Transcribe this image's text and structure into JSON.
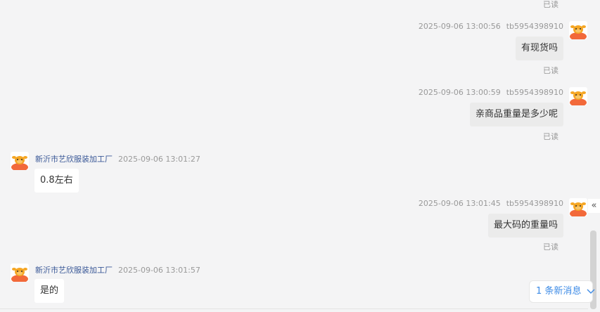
{
  "top_read": "已读",
  "messages": [
    {
      "time": "2025-09-06 13:00:56",
      "sender": "tb5954398910",
      "text": "有现货吗",
      "read": "已读"
    },
    {
      "time": "2025-09-06 13:00:59",
      "sender": "tb5954398910",
      "text": "亲商品重量是多少呢",
      "read": "已读"
    },
    {
      "time": "2025-09-06 13:01:27",
      "sender": "新沂市艺欣服装加工厂",
      "text": "0.8左右"
    },
    {
      "time": "2025-09-06 13:01:45",
      "sender": "tb5954398910",
      "text": "最大码的重量吗",
      "read": "已读"
    },
    {
      "time": "2025-09-06 13:01:57",
      "sender": "新沂市艺欣服装加工厂",
      "text": "是的"
    }
  ],
  "new_message_label": "1 条新消息",
  "collapse_glyph": "«",
  "icons": {
    "avatar": "cartoon-cow-avatar-icon",
    "chevron": "chevron-down-icon",
    "collapse": "double-chevron-left-icon"
  },
  "colors": {
    "background": "#f4f4f5",
    "sender_name": "#3a5897",
    "new_message": "#3d8be6",
    "bubble_out": "#ebebeb",
    "bubble_in": "#ffffff"
  }
}
